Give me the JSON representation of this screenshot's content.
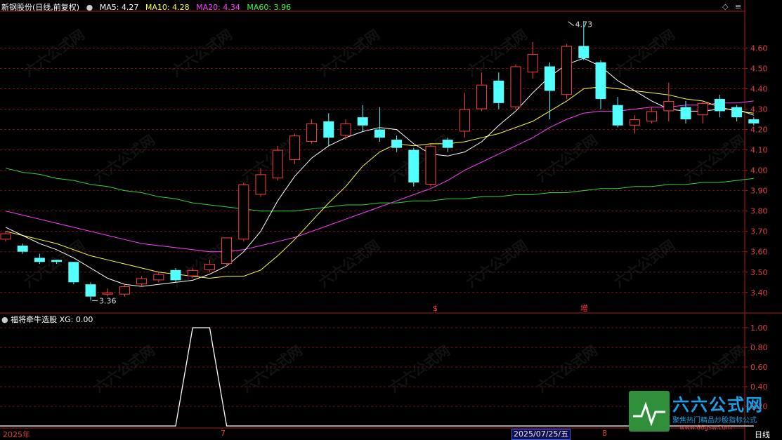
{
  "header": {
    "stock": "新钢股份(日线,前复权)",
    "ma": [
      {
        "label": "MA5: 4.27",
        "color": "#ffffff"
      },
      {
        "label": "MA10: 4.28",
        "color": "#ffff40"
      },
      {
        "label": "MA20: 4.34",
        "color": "#ff40ff"
      },
      {
        "label": "MA60: 3.96",
        "color": "#40ff40"
      }
    ]
  },
  "indicator": {
    "title": "福将牵牛选股",
    "xg_label": "XG: 0.00"
  },
  "colors": {
    "up": "#ff4040",
    "down": "#54ffff",
    "ma5": "#ffffff",
    "ma10": "#ffff40",
    "ma20": "#ff40ff",
    "ma60": "#30d830",
    "grid": "#7a1010",
    "axis": "#b01818"
  },
  "icons": [
    "chevron-down-icon",
    "diamond-icon",
    "menu-icon",
    "arrow-up-icon"
  ],
  "bottom": {
    "year": "2025年",
    "month7": "7",
    "date": "2025/07/25/五",
    "month8": "8",
    "period": "日线"
  },
  "markers": {
    "s": "$",
    "zeng": "增"
  },
  "logo": {
    "name": "六六公式网",
    "tagline": "聚焦热门精品炒股指标公式",
    "url": "www.66gsw.com"
  },
  "watermark": "六六公式网",
  "chart_data": {
    "type": "candlestick",
    "price_axis": {
      "ticks": [
        "4.60",
        "4.50",
        "4.40",
        "4.30",
        "4.20",
        "4.10",
        "4.00",
        "3.90",
        "3.80",
        "3.70",
        "3.60",
        "3.50",
        "3.40"
      ],
      "range": [
        3.32,
        4.76
      ]
    },
    "indicator_axis": {
      "ticks": [
        "1.00",
        "0.80",
        "0.60",
        "0.40",
        "0.20"
      ],
      "range": [
        0,
        1.05
      ]
    },
    "annotations": [
      {
        "label": "4.73",
        "candle": 33,
        "value": 4.73
      },
      {
        "label": "3.36",
        "candle": 5,
        "value": 3.36
      }
    ],
    "candles": [
      [
        3.66,
        3.69,
        3.65,
        3.7
      ],
      [
        3.63,
        3.6,
        3.59,
        3.64
      ],
      [
        3.57,
        3.55,
        3.54,
        3.59
      ],
      [
        3.56,
        3.55,
        3.54,
        3.56
      ],
      [
        3.55,
        3.45,
        3.44,
        3.55
      ],
      [
        3.44,
        3.38,
        3.36,
        3.45
      ],
      [
        3.39,
        3.4,
        3.38,
        3.42
      ],
      [
        3.39,
        3.43,
        3.38,
        3.44
      ],
      [
        3.44,
        3.47,
        3.43,
        3.48
      ],
      [
        3.46,
        3.49,
        3.45,
        3.5
      ],
      [
        3.51,
        3.46,
        3.45,
        3.52
      ],
      [
        3.48,
        3.51,
        3.47,
        3.52
      ],
      [
        3.51,
        3.54,
        3.5,
        3.56
      ],
      [
        3.54,
        3.67,
        3.53,
        3.67
      ],
      [
        3.66,
        3.93,
        3.65,
        3.94
      ],
      [
        3.88,
        3.98,
        3.87,
        4.01
      ],
      [
        3.96,
        4.1,
        3.95,
        4.12
      ],
      [
        4.05,
        4.17,
        4.03,
        4.18
      ],
      [
        4.14,
        4.23,
        4.13,
        4.25
      ],
      [
        4.24,
        4.16,
        4.12,
        4.28
      ],
      [
        4.17,
        4.23,
        4.15,
        4.25
      ],
      [
        4.26,
        4.22,
        4.19,
        4.32
      ],
      [
        4.2,
        4.16,
        4.14,
        4.31
      ],
      [
        4.15,
        4.11,
        4.09,
        4.17
      ],
      [
        4.1,
        3.94,
        3.92,
        4.11
      ],
      [
        3.93,
        4.12,
        3.92,
        4.13
      ],
      [
        4.15,
        4.11,
        4.09,
        4.16
      ],
      [
        4.19,
        4.3,
        4.16,
        4.38
      ],
      [
        4.3,
        4.42,
        4.29,
        4.48
      ],
      [
        4.44,
        4.33,
        4.3,
        4.48
      ],
      [
        4.31,
        4.51,
        4.3,
        4.52
      ],
      [
        4.48,
        4.57,
        4.45,
        4.63
      ],
      [
        4.51,
        4.39,
        4.25,
        4.53
      ],
      [
        4.37,
        4.61,
        4.35,
        4.62
      ],
      [
        4.61,
        4.55,
        4.54,
        4.73
      ],
      [
        4.53,
        4.35,
        4.3,
        4.54
      ],
      [
        4.32,
        4.22,
        4.21,
        4.36
      ],
      [
        4.22,
        4.25,
        4.18,
        4.27
      ],
      [
        4.24,
        4.29,
        4.23,
        4.31
      ],
      [
        4.29,
        4.34,
        4.24,
        4.43
      ],
      [
        4.31,
        4.25,
        4.23,
        4.34
      ],
      [
        4.27,
        4.33,
        4.23,
        4.34
      ],
      [
        4.35,
        4.29,
        4.26,
        4.37
      ],
      [
        4.31,
        4.26,
        4.24,
        4.32
      ],
      [
        4.25,
        4.23,
        4.22,
        4.26
      ]
    ],
    "ma5": [
      3.72,
      3.68,
      3.64,
      3.61,
      3.57,
      3.52,
      3.47,
      3.44,
      3.43,
      3.44,
      3.45,
      3.46,
      3.49,
      3.53,
      3.6,
      3.7,
      3.85,
      3.97,
      4.06,
      4.12,
      4.16,
      4.19,
      4.21,
      4.2,
      4.13,
      4.08,
      4.07,
      4.09,
      4.14,
      4.22,
      4.29,
      4.38,
      4.46,
      4.52,
      4.55,
      4.51,
      4.44,
      4.39,
      4.34,
      4.3,
      4.29,
      4.29,
      4.3,
      4.3,
      4.27
    ],
    "ma10": [
      3.7,
      3.68,
      3.66,
      3.64,
      3.61,
      3.58,
      3.56,
      3.54,
      3.52,
      3.5,
      3.49,
      3.48,
      3.47,
      3.48,
      3.48,
      3.51,
      3.58,
      3.66,
      3.75,
      3.84,
      3.92,
      4.02,
      4.09,
      4.13,
      4.12,
      4.13,
      4.13,
      4.14,
      4.16,
      4.18,
      4.21,
      4.24,
      4.29,
      4.34,
      4.4,
      4.41,
      4.4,
      4.39,
      4.38,
      4.37,
      4.35,
      4.34,
      4.31,
      4.29,
      4.28
    ],
    "ma20": [
      3.8,
      3.78,
      3.76,
      3.74,
      3.72,
      3.7,
      3.68,
      3.66,
      3.64,
      3.63,
      3.62,
      3.61,
      3.6,
      3.6,
      3.61,
      3.63,
      3.65,
      3.67,
      3.7,
      3.73,
      3.76,
      3.79,
      3.82,
      3.85,
      3.88,
      3.91,
      3.95,
      4.0,
      4.04,
      4.08,
      4.12,
      4.16,
      4.21,
      4.25,
      4.28,
      4.29,
      4.29,
      4.3,
      4.31,
      4.31,
      4.32,
      4.32,
      4.33,
      4.33,
      4.34
    ],
    "ma60": [
      4.01,
      3.99,
      3.98,
      3.96,
      3.95,
      3.93,
      3.92,
      3.9,
      3.89,
      3.87,
      3.86,
      3.84,
      3.83,
      3.82,
      3.81,
      3.8,
      3.8,
      3.8,
      3.81,
      3.82,
      3.83,
      3.83,
      3.84,
      3.84,
      3.85,
      3.85,
      3.86,
      3.86,
      3.87,
      3.87,
      3.88,
      3.88,
      3.89,
      3.89,
      3.9,
      3.91,
      3.91,
      3.92,
      3.92,
      3.93,
      3.93,
      3.94,
      3.94,
      3.95,
      3.96
    ],
    "xg": [
      0,
      0,
      0,
      0,
      0,
      0,
      0,
      0,
      0,
      0,
      0,
      1,
      1,
      0,
      0,
      0,
      0,
      0,
      0,
      0,
      0,
      0,
      0,
      0,
      0,
      0,
      0,
      0,
      0,
      0,
      0,
      0,
      0,
      0,
      0,
      0,
      0,
      0,
      0,
      0,
      0,
      0,
      0,
      0,
      0
    ]
  }
}
